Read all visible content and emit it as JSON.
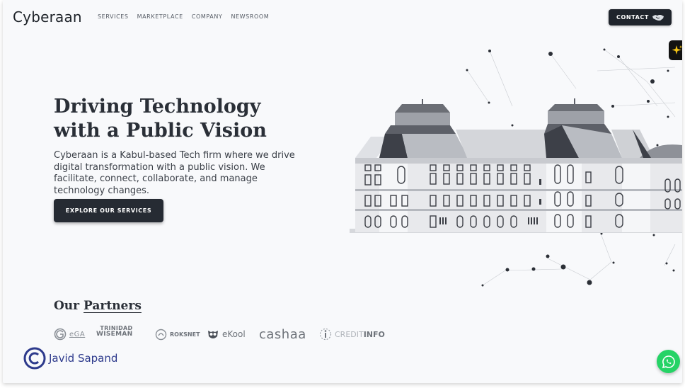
{
  "header": {
    "logo": "Cyberaan",
    "nav": [
      "SERVICES",
      "MARKETPLACE",
      "COMPANY",
      "NEWSROOM"
    ],
    "contact_label": "CONTACT"
  },
  "hero": {
    "title_line1": "Driving Technology",
    "title_line2": "with a Public Vision",
    "description": "Cyberaan is a Kabul-based Tech firm where we drive digital transformation with a public vision. We facilitate, connect, collaborate, and manage technology changes.",
    "cta_label": "EXPLORE OUR SERVICES"
  },
  "partners": {
    "title_prefix": "Our",
    "title_underlined": "Partners",
    "logos": [
      {
        "name": "eGA",
        "text": "eGA"
      },
      {
        "name": "trinidad-wiseman",
        "line1": "TRINIDAD",
        "line2": "WISEMAN"
      },
      {
        "name": "roksnet",
        "text": "ROKSNET"
      },
      {
        "name": "ekool",
        "text": "eKool"
      },
      {
        "name": "cashaa",
        "text": "cashaa"
      },
      {
        "name": "creditinfo",
        "text_light": "CREDIT",
        "text_bold": "INFO"
      }
    ]
  },
  "watermark": {
    "text": "Javid Sapand"
  },
  "colors": {
    "dark": "#262b33",
    "background": "#f8f9fb",
    "whatsapp": "#25d366",
    "watermark": "#2d3a8c"
  }
}
